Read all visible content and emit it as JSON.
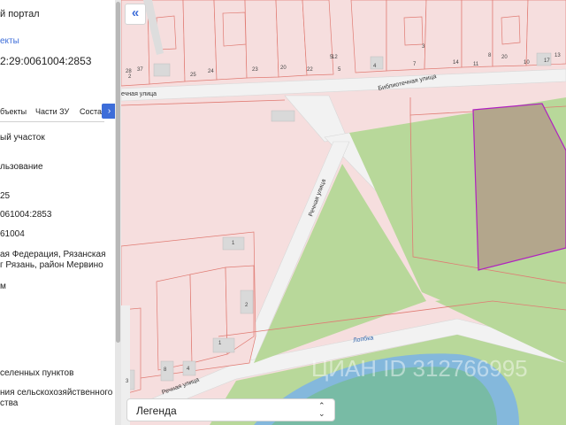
{
  "panel": {
    "portal_title": "й портал",
    "objects_link": "екты",
    "cadastral_number": "2:29:0061004:2853",
    "tabs": [
      {
        "label": "бъекты"
      },
      {
        "label": "Части ЗУ"
      },
      {
        "label": "Состав"
      }
    ],
    "tab_next_glyph": "›",
    "fields": [
      {
        "text": "ый участок"
      },
      {
        "text": "льзование"
      },
      {
        "text": "25"
      },
      {
        "text": "061004:2853"
      },
      {
        "text": "61004"
      },
      {
        "text": "ая Федерация, Рязанская"
      },
      {
        "text": "г Рязань, район Мервино"
      },
      {
        "text": "м"
      },
      {
        "text": "селенных пунктов"
      },
      {
        "text": "ния сельскохозяйственного"
      },
      {
        "text": "ства"
      }
    ]
  },
  "map": {
    "collapse_glyph": "«",
    "streets": {
      "upper": "ечная улица",
      "bibliotechnaya": "Библиотечная улица",
      "rechnaya_vertical": "Речная улица",
      "rechnaya_bottom": "Речная улица",
      "river": "Лопбка"
    },
    "plot_numbers": [
      "28",
      "37",
      "25",
      "24",
      "23",
      "20",
      "22",
      "12",
      "5",
      "4",
      "7",
      "14",
      "11",
      "3",
      "8",
      "20",
      "10",
      "17",
      "13",
      "5",
      "2",
      "1",
      "1",
      "3",
      "8",
      "4",
      "2"
    ],
    "legend": {
      "label": "Легенда",
      "chevron": "⌃⌄"
    },
    "watermark": "ЦИАН ID 312766995",
    "colors": {
      "parcel_fill": "#f6dede",
      "parcel_line": "#e07b73",
      "road": "#f2f2f2",
      "green": "#b8d89a",
      "water": "#7ab3e8",
      "selected_fill": "#b3a68c",
      "selected_line": "#b020c0"
    }
  }
}
